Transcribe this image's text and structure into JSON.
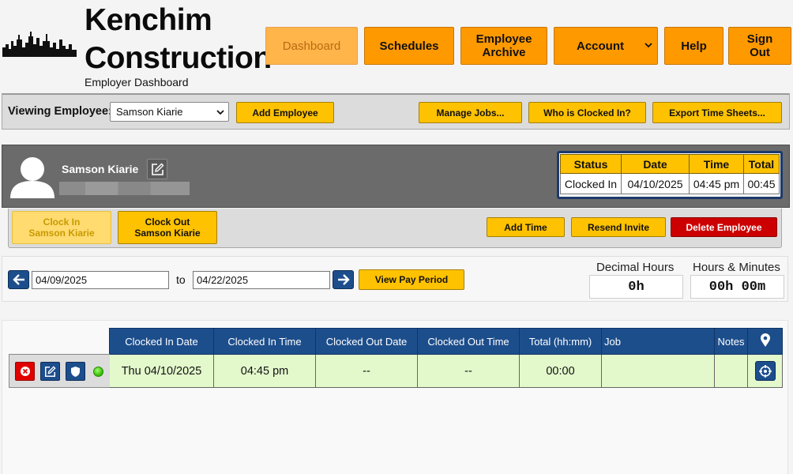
{
  "brand": {
    "name_line1": "Kenchim",
    "name_line2": "Construction",
    "subtitle": "Employer Dashboard"
  },
  "nav": {
    "dashboard": "Dashboard",
    "schedules": "Schedules",
    "archive_line1": "Employee",
    "archive_line2": "Archive",
    "account": "Account",
    "help": "Help",
    "signout_line1": "Sign",
    "signout_line2": "Out"
  },
  "viewing": {
    "label": "Viewing Employee:",
    "selected": "Samson Kiarie",
    "add_employee": "Add Employee",
    "manage_jobs": "Manage Jobs...",
    "who_clocked_in": "Who is Clocked In?",
    "export_time_sheets": "Export Time Sheets..."
  },
  "employee": {
    "name": "Samson Kiarie"
  },
  "status": {
    "headers": [
      "Status",
      "Date",
      "Time",
      "Total"
    ],
    "values": [
      "Clocked In",
      "04/10/2025",
      "04:45 pm",
      "00:45"
    ]
  },
  "clock": {
    "in_line1": "Clock In",
    "in_line2": "Samson Kiarie",
    "out_line1": "Clock Out",
    "out_line2": "Samson Kiarie",
    "add_time": "Add Time",
    "resend_invite": "Resend Invite",
    "delete_employee": "Delete Employee"
  },
  "range": {
    "start": "04/09/2025",
    "to": "to",
    "end": "04/22/2025",
    "view_pay_period": "View Pay Period",
    "decimal_label": "Decimal Hours",
    "decimal_value": "0h",
    "hm_label": "Hours & Minutes",
    "hm_value": "00h 00m"
  },
  "records": {
    "headers": [
      "Clocked In Date",
      "Clocked In Time",
      "Clocked Out Date",
      "Clocked Out Time",
      "Total (hh:mm)",
      "Job",
      "Notes"
    ],
    "rows": [
      [
        "Thu 04/10/2025",
        "04:45 pm",
        "--",
        "--",
        "00:00",
        "",
        ""
      ]
    ]
  },
  "colors": {
    "nav_orange": "#ff9900",
    "button_yellow": "#ffc200",
    "delete_red": "#cc0000",
    "header_blue": "#1d4e8c",
    "row_green": "#e3f9cc",
    "panel_gray": "#6b6b6b"
  },
  "icons": {
    "skyline": "city-skyline-logo",
    "avatar": "user-avatar-icon",
    "edit": "pencil-square-icon",
    "prev": "arrow-left-icon",
    "next": "arrow-right-icon",
    "location": "map-pin-icon",
    "delete_row": "close-circle-icon",
    "edit_row": "edit-icon",
    "badge": "shield-icon",
    "status": "status-dot",
    "gps": "crosshair-icon"
  }
}
